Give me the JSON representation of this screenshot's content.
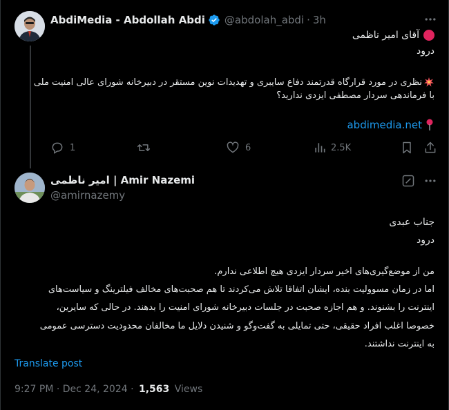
{
  "quoted_post": {
    "display_name": "AbdiMedia - Abdollah Abdi",
    "handle": "@abdolah_abdi",
    "separator": "·",
    "time": "3h",
    "line1": "آقای امیر ناظمی",
    "line2": "درود",
    "question_line1": "نظری در مورد قرارگاه قدرتمند دفاع سایبری و تهدیدات نوین مستقر در دبیرخانه شورای عالی امنیت ملی",
    "question_line2": "با فرماندهی سردار مصطفی ایزدی ندارید؟",
    "link": "abdimedia.net",
    "actions": {
      "replies": "1",
      "likes": "6",
      "views": "2.5K"
    }
  },
  "reply_post": {
    "display_name": "امیر ناظمی | Amir Nazemi",
    "handle": "@amirnazemy",
    "greeting_line1": "جناب عبدی",
    "greeting_line2": "درود",
    "body_line1": "من از موضع‌گیری‌های اخیر سردار ایزدی هیچ اطلاعی ندارم.",
    "body_line2": "اما در زمان مسوولیت بنده، ایشان اتفاقا تلاش می‌کردند تا هم صحبت‌های مخالف فیلترینگ و سیاست‌های",
    "body_line3": "اینترنت را بشنوند. و هم اجازه صحبت در جلسات دبیرخانه شورای امنیت را بدهند. در حالی که سایرین،",
    "body_line4": "خصوصا اغلب افراد حقیقی، حتی تمایلی به گفت‌وگو و شنیدن دلایل ما مخالفان محدودیت دسترسی عمومی",
    "body_line5": "به اینترنت نداشتند.",
    "translate": "Translate post",
    "timestamp": "9:27 PM · Dec 24, 2024 ·",
    "view_count": "1,563",
    "views_label": "Views"
  },
  "colors": {
    "background": "#000000",
    "text": "#e7e9ea",
    "secondary": "#71767b",
    "accent": "#1d9bf0",
    "red_dot": "#e0245e"
  },
  "icons": [
    "more-icon",
    "verified-badge-icon",
    "red-circle-icon",
    "collision-emoji-icon",
    "pin-icon",
    "reply-icon",
    "retweet-icon",
    "like-icon",
    "views-icon",
    "bookmark-icon",
    "share-icon",
    "grok-icon"
  ]
}
